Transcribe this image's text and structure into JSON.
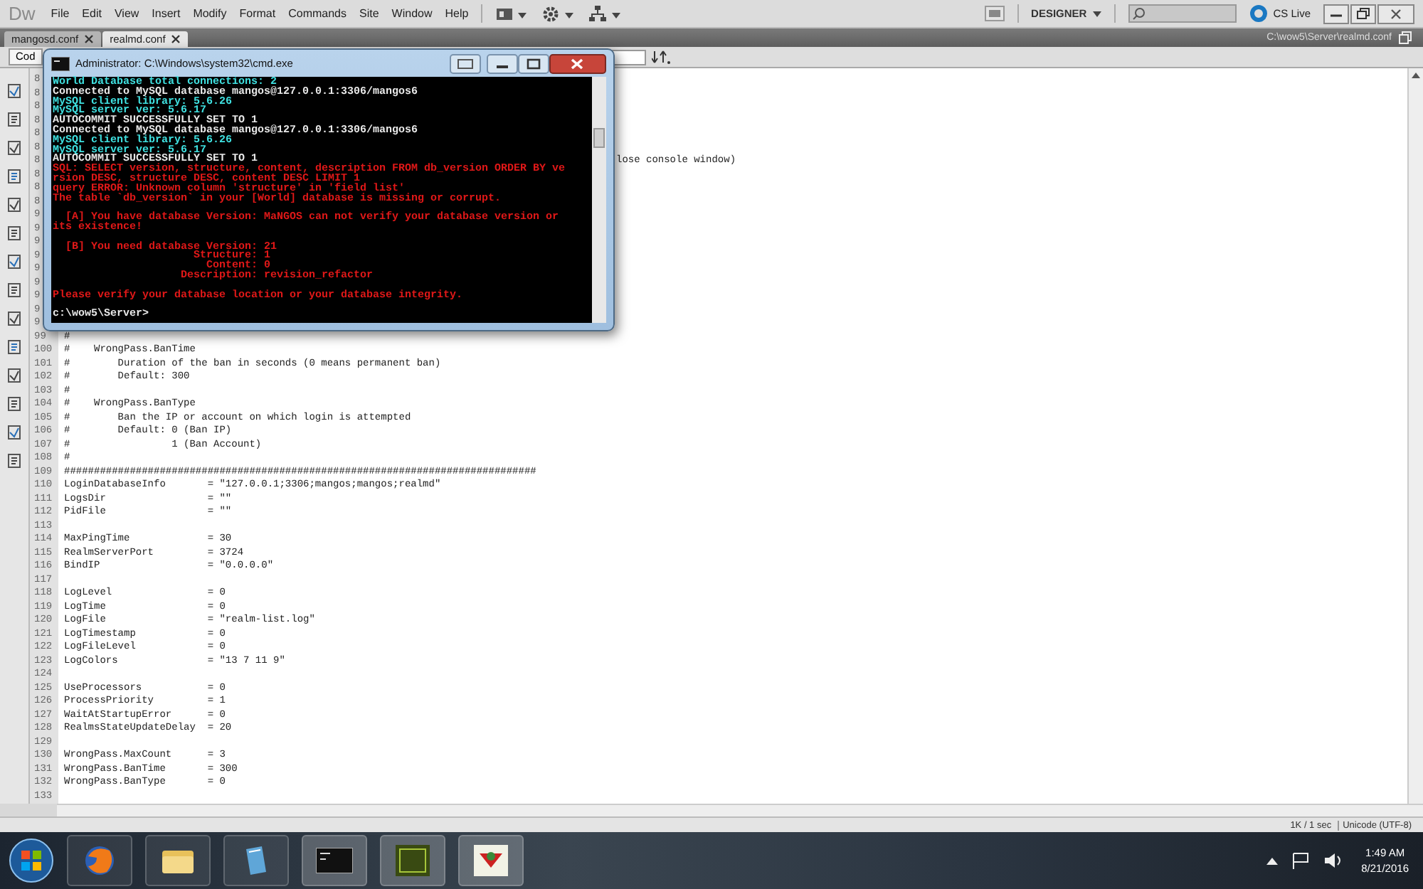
{
  "menu_bar": {
    "logo": "Dw",
    "items": [
      "File",
      "Edit",
      "View",
      "Insert",
      "Modify",
      "Format",
      "Commands",
      "Site",
      "Window",
      "Help"
    ],
    "workspace": "DESIGNER",
    "cs_live": "CS Live"
  },
  "tabs": [
    {
      "label": "mangosd.conf",
      "selected": false
    },
    {
      "label": "realmd.conf",
      "selected": true
    }
  ],
  "file_path": "C:\\wow5\\Server\\realmd.conf",
  "toolbar": {
    "view_button": "Cod"
  },
  "editor": {
    "lines": [
      {
        "number": "8",
        "kind": "covered"
      },
      {
        "number": "8",
        "kind": "covered"
      },
      {
        "number": "8",
        "kind": "covered"
      },
      {
        "number": "8",
        "kind": "covered"
      },
      {
        "number": "8",
        "kind": "covered"
      },
      {
        "number": "8",
        "kind": "covered"
      },
      {
        "number": "8",
        "kind": "covered",
        "text": "lose console window)"
      },
      {
        "number": "8",
        "kind": "covered"
      },
      {
        "number": "8",
        "kind": "covered"
      },
      {
        "number": "8",
        "kind": "covered"
      },
      {
        "number": "9",
        "kind": "covered"
      },
      {
        "number": "9",
        "kind": "covered"
      },
      {
        "number": "9",
        "kind": "covered"
      },
      {
        "number": "9",
        "kind": "covered"
      },
      {
        "number": "9",
        "kind": "covered"
      },
      {
        "number": "9",
        "kind": "covered"
      },
      {
        "number": "9",
        "kind": "covered"
      },
      {
        "number": "9",
        "kind": "covered"
      },
      {
        "number": "9",
        "kind": "covered"
      },
      {
        "number": "99",
        "kind": "code",
        "text": "#"
      },
      {
        "number": "100",
        "kind": "code",
        "text": "#    WrongPass.BanTime"
      },
      {
        "number": "101",
        "kind": "code",
        "text": "#        Duration of the ban in seconds (0 means permanent ban)"
      },
      {
        "number": "102",
        "kind": "code",
        "text": "#        Default: 300"
      },
      {
        "number": "103",
        "kind": "code",
        "text": "#"
      },
      {
        "number": "104",
        "kind": "code",
        "text": "#    WrongPass.BanType"
      },
      {
        "number": "105",
        "kind": "code",
        "text": "#        Ban the IP or account on which login is attempted"
      },
      {
        "number": "106",
        "kind": "code",
        "text": "#        Default: 0 (Ban IP)"
      },
      {
        "number": "107",
        "kind": "code",
        "text": "#                 1 (Ban Account)"
      },
      {
        "number": "108",
        "kind": "code",
        "text": "#"
      },
      {
        "number": "109",
        "kind": "code",
        "text": "###############################################################################"
      },
      {
        "number": "110",
        "kind": "code",
        "text": "LoginDatabaseInfo       = \"127.0.0.1;3306;mangos;mangos;realmd\""
      },
      {
        "number": "111",
        "kind": "code",
        "text": "LogsDir                 = \"\""
      },
      {
        "number": "112",
        "kind": "code",
        "text": "PidFile                 = \"\""
      },
      {
        "number": "113",
        "kind": "code"
      },
      {
        "number": "114",
        "kind": "code",
        "text": "MaxPingTime             = 30"
      },
      {
        "number": "115",
        "kind": "code",
        "text": "RealmServerPort         = 3724"
      },
      {
        "number": "116",
        "kind": "code",
        "text": "BindIP                  = \"0.0.0.0\""
      },
      {
        "number": "117",
        "kind": "code"
      },
      {
        "number": "118",
        "kind": "code",
        "text": "LogLevel                = 0"
      },
      {
        "number": "119",
        "kind": "code",
        "text": "LogTime                 = 0"
      },
      {
        "number": "120",
        "kind": "code",
        "text": "LogFile                 = \"realm-list.log\""
      },
      {
        "number": "121",
        "kind": "code",
        "text": "LogTimestamp            = 0"
      },
      {
        "number": "122",
        "kind": "code",
        "text": "LogFileLevel            = 0"
      },
      {
        "number": "123",
        "kind": "code",
        "text": "LogColors               = \"13 7 11 9\""
      },
      {
        "number": "124",
        "kind": "code"
      },
      {
        "number": "125",
        "kind": "code",
        "text": "UseProcessors           = 0"
      },
      {
        "number": "126",
        "kind": "code",
        "text": "ProcessPriority         = 1"
      },
      {
        "number": "127",
        "kind": "code",
        "text": "WaitAtStartupError      = 0"
      },
      {
        "number": "128",
        "kind": "code",
        "text": "RealmsStateUpdateDelay  = 20"
      },
      {
        "number": "129",
        "kind": "code"
      },
      {
        "number": "130",
        "kind": "code",
        "text": "WrongPass.MaxCount      = 3"
      },
      {
        "number": "131",
        "kind": "code",
        "text": "WrongPass.BanTime       = 300"
      },
      {
        "number": "132",
        "kind": "code",
        "text": "WrongPass.BanType       = 0"
      },
      {
        "number": "133",
        "kind": "code"
      }
    ]
  },
  "status_bar": {
    "size": "1K / 1 sec",
    "encoding": "Unicode (UTF-8)"
  },
  "console_window": {
    "title": "Administrator: C:\\Windows\\system32\\cmd.exe",
    "lines": [
      {
        "kind": "info",
        "text": "World Database total connections: 2"
      },
      {
        "kind": "plain",
        "text": "Connected to MySQL database mangos@127.0.0.1:3306/mangos6"
      },
      {
        "kind": "info",
        "text": "MySQL client library: 5.6.26"
      },
      {
        "kind": "info",
        "text": "MySQL server ver: 5.6.17"
      },
      {
        "kind": "plain",
        "text": "AUTOCOMMIT SUCCESSFULLY SET TO 1"
      },
      {
        "kind": "plain",
        "text": "Connected to MySQL database mangos@127.0.0.1:3306/mangos6"
      },
      {
        "kind": "info",
        "text": "MySQL client library: 5.6.26"
      },
      {
        "kind": "info",
        "text": "MySQL server ver: 5.6.17"
      },
      {
        "kind": "plain",
        "text": "AUTOCOMMIT SUCCESSFULLY SET TO 1"
      },
      {
        "kind": "error",
        "text": "SQL: SELECT version, structure, content, description FROM db_version ORDER BY ve"
      },
      {
        "kind": "error",
        "text": "rsion DESC, structure DESC, content DESC LIMIT 1"
      },
      {
        "kind": "error",
        "text": "query ERROR: Unknown column 'structure' in 'field list'"
      },
      {
        "kind": "error",
        "text": "The table `db_version` in your [World] database is missing or corrupt."
      },
      {
        "kind": "blank"
      },
      {
        "kind": "error",
        "text": "  [A] You have database Version: MaNGOS can not verify your database version or"
      },
      {
        "kind": "error",
        "text": "its existence!"
      },
      {
        "kind": "blank"
      },
      {
        "kind": "error",
        "text": "  [B] You need database Version: 21"
      },
      {
        "kind": "error",
        "text": "                      Structure: 1"
      },
      {
        "kind": "error",
        "text": "                        Content: 0"
      },
      {
        "kind": "error",
        "text": "                    Description: revision_refactor"
      },
      {
        "kind": "blank"
      },
      {
        "kind": "error",
        "text": "Please verify your database location or your database integrity."
      },
      {
        "kind": "blank"
      },
      {
        "kind": "plain",
        "text": "c:\\wow5\\Server>"
      }
    ]
  },
  "taskbar": {
    "time": "1:49 AM",
    "date": "8/21/2016"
  }
}
